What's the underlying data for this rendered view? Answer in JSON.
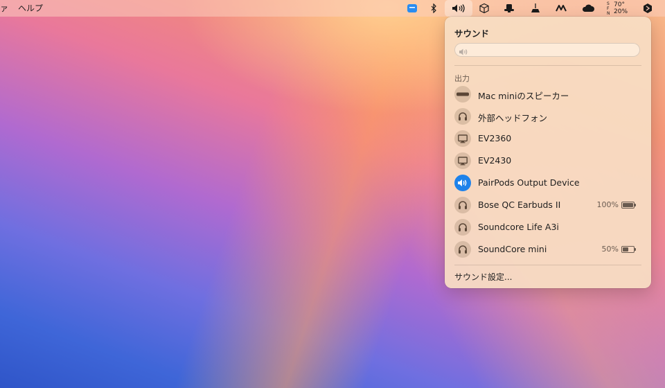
{
  "menubar": {
    "left_items": [
      "ァ",
      "ヘルプ"
    ],
    "icons": [
      "finder-badge-icon",
      "bluetooth-icon",
      "volume-icon",
      "cube-icon",
      "hat-icon",
      "broom-icon",
      "flow-icon",
      "cloud-icon"
    ],
    "weather": {
      "prefix": "S FN",
      "temp": "70°",
      "humidity": "20%"
    }
  },
  "sound_panel": {
    "title": "サウンド",
    "volume_level": 0,
    "output_label": "出力",
    "devices": [
      {
        "name": "Mac miniのスピーカー",
        "icon": "speaker-bar-icon",
        "selected": false,
        "battery": null
      },
      {
        "name": "外部ヘッドフォン",
        "icon": "headphones-icon",
        "selected": false,
        "battery": null
      },
      {
        "name": "EV2360",
        "icon": "display-icon",
        "selected": false,
        "battery": null
      },
      {
        "name": "EV2430",
        "icon": "display-icon",
        "selected": false,
        "battery": null
      },
      {
        "name": "PairPods Output Device",
        "icon": "speaker-wave-icon",
        "selected": true,
        "battery": null
      },
      {
        "name": "Bose QC Earbuds II",
        "icon": "headphones-icon",
        "selected": false,
        "battery": "100%",
        "battery_fraction": 1.0
      },
      {
        "name": "Soundcore Life A3i",
        "icon": "headphones-icon",
        "selected": false,
        "battery": null
      },
      {
        "name": "SoundCore mini",
        "icon": "headphones-icon",
        "selected": false,
        "battery": "50%",
        "battery_fraction": 0.5
      }
    ],
    "settings_label": "サウンド設定...",
    "accent_color": "#1e82ea"
  }
}
